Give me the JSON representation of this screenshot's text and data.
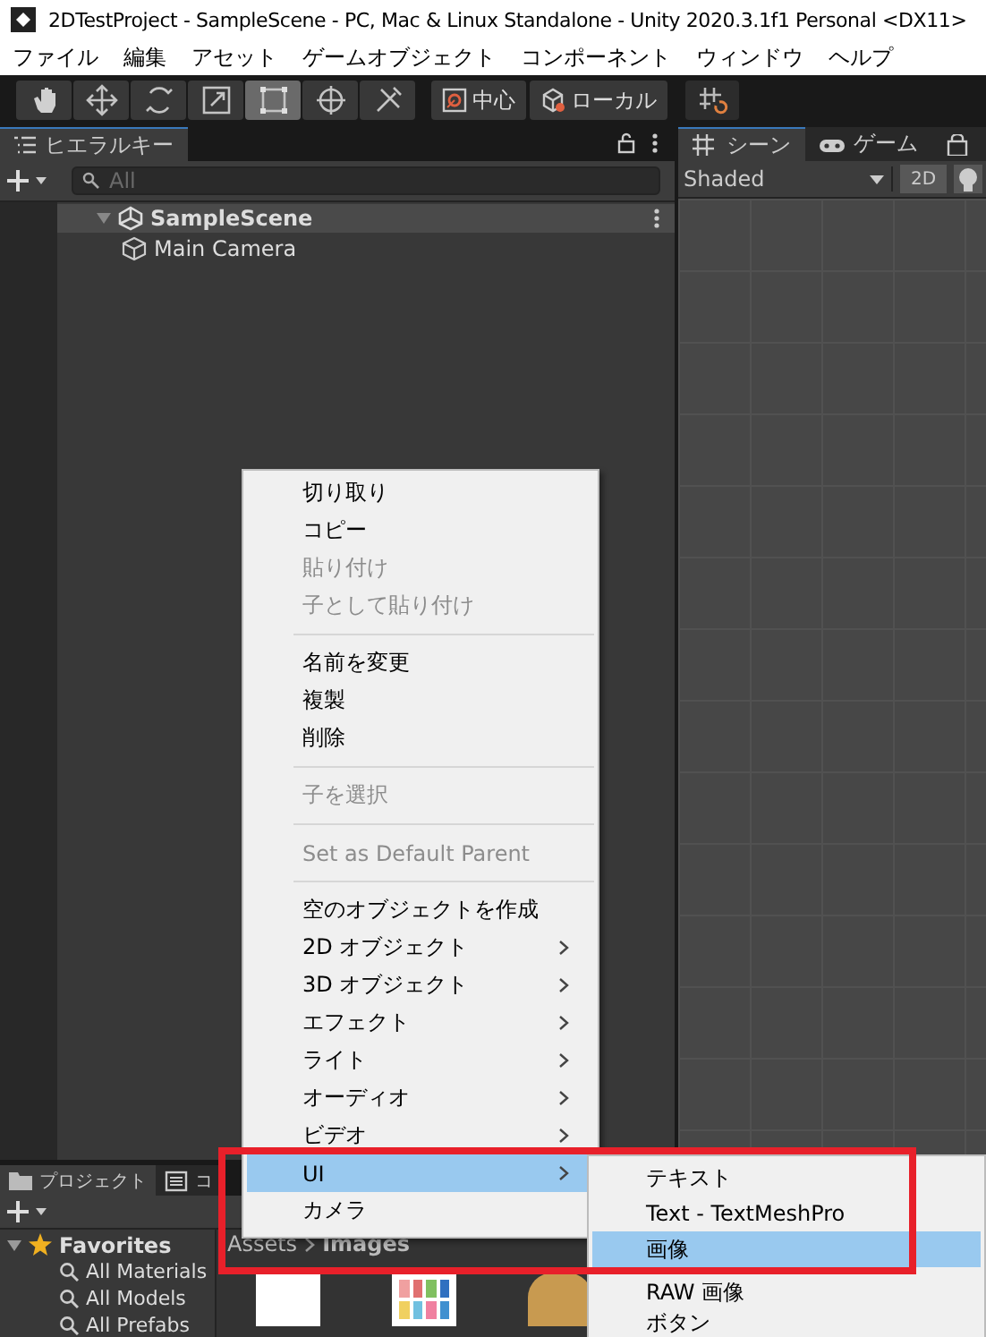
{
  "window": {
    "title": "2DTestProject - SampleScene - PC, Mac & Linux Standalone - Unity 2020.3.1f1 Personal <DX11>"
  },
  "menu_bar": [
    "ファイル",
    "編集",
    "アセット",
    "ゲームオブジェクト",
    "コンポーネント",
    "ウィンドウ",
    "ヘルプ"
  ],
  "toolbar": {
    "tools": [
      {
        "kind": "hand",
        "selected": false
      },
      {
        "kind": "move",
        "selected": false
      },
      {
        "kind": "rotate",
        "selected": false
      },
      {
        "kind": "scale",
        "selected": false
      },
      {
        "kind": "rect",
        "selected": true
      },
      {
        "kind": "transform",
        "selected": false
      },
      {
        "kind": "custom",
        "selected": false
      }
    ],
    "handles": [
      {
        "kind": "pivot",
        "label": "中心"
      },
      {
        "kind": "space",
        "label": "ローカル"
      }
    ]
  },
  "hierarchy": {
    "tab": "ヒエラルキー",
    "search": {
      "placeholder": "All"
    },
    "tree": [
      {
        "kind": "scene",
        "label": "SampleScene",
        "expanded": true,
        "children": [
          {
            "kind": "object",
            "label": "Main Camera"
          }
        ]
      }
    ]
  },
  "scene_panel": {
    "tabs": [
      {
        "kind": "scene",
        "label": "シーン",
        "selected": true
      },
      {
        "kind": "game",
        "label": "ゲーム",
        "selected": false
      },
      {
        "kind": "store",
        "selected": false
      }
    ],
    "shading": "Shaded",
    "mode_button": "2D"
  },
  "context_menu": {
    "items": [
      {
        "kind": "item",
        "label": "切り取り",
        "disabled": false,
        "submenu": false,
        "selected": false
      },
      {
        "kind": "item",
        "label": "コピー",
        "disabled": false,
        "submenu": false,
        "selected": false
      },
      {
        "kind": "item",
        "label": "貼り付け",
        "disabled": true,
        "submenu": false,
        "selected": false
      },
      {
        "kind": "item",
        "label": "子として貼り付け",
        "disabled": true,
        "submenu": false,
        "selected": false
      },
      {
        "kind": "separator"
      },
      {
        "kind": "item",
        "label": "名前を変更",
        "disabled": false,
        "submenu": false,
        "selected": false
      },
      {
        "kind": "item",
        "label": "複製",
        "disabled": false,
        "submenu": false,
        "selected": false
      },
      {
        "kind": "item",
        "label": "削除",
        "disabled": false,
        "submenu": false,
        "selected": false
      },
      {
        "kind": "separator"
      },
      {
        "kind": "item",
        "label": "子を選択",
        "disabled": true,
        "submenu": false,
        "selected": false
      },
      {
        "kind": "separator"
      },
      {
        "kind": "item",
        "label": "Set as Default Parent",
        "disabled": true,
        "submenu": false,
        "selected": false
      },
      {
        "kind": "separator"
      },
      {
        "kind": "item",
        "label": "空のオブジェクトを作成",
        "disabled": false,
        "submenu": false,
        "selected": false
      },
      {
        "kind": "item",
        "label": "2D オブジェクト",
        "disabled": false,
        "submenu": true,
        "selected": false
      },
      {
        "kind": "item",
        "label": "3D オブジェクト",
        "disabled": false,
        "submenu": true,
        "selected": false
      },
      {
        "kind": "item",
        "label": "エフェクト",
        "disabled": false,
        "submenu": true,
        "selected": false
      },
      {
        "kind": "item",
        "label": "ライト",
        "disabled": false,
        "submenu": true,
        "selected": false
      },
      {
        "kind": "item",
        "label": "オーディオ",
        "disabled": false,
        "submenu": true,
        "selected": false
      },
      {
        "kind": "item",
        "label": "ビデオ",
        "disabled": false,
        "submenu": true,
        "selected": false
      },
      {
        "kind": "item",
        "label": "UI",
        "disabled": false,
        "submenu": true,
        "selected": true
      },
      {
        "kind": "item",
        "label": "カメラ",
        "disabled": false,
        "submenu": false,
        "selected": false
      }
    ]
  },
  "submenu": {
    "items": [
      {
        "label": "テキスト",
        "selected": false
      },
      {
        "label": "Text - TextMeshPro",
        "selected": false
      },
      {
        "label": "画像",
        "selected": true
      },
      {
        "label": "RAW 画像",
        "selected": false
      },
      {
        "label": "ボタン",
        "selected": false
      }
    ]
  },
  "project": {
    "tabs": [
      {
        "kind": "project",
        "label": "プロジェクト",
        "selected": true
      },
      {
        "kind": "console",
        "label": "コ",
        "selected": false
      }
    ],
    "favorites": {
      "label": "Favorites",
      "expanded": true,
      "children": [
        {
          "label": "All Materials"
        },
        {
          "label": "All Models"
        },
        {
          "label": "All Prefabs"
        }
      ]
    },
    "breadcrumb": [
      "Assets",
      "Images"
    ]
  }
}
